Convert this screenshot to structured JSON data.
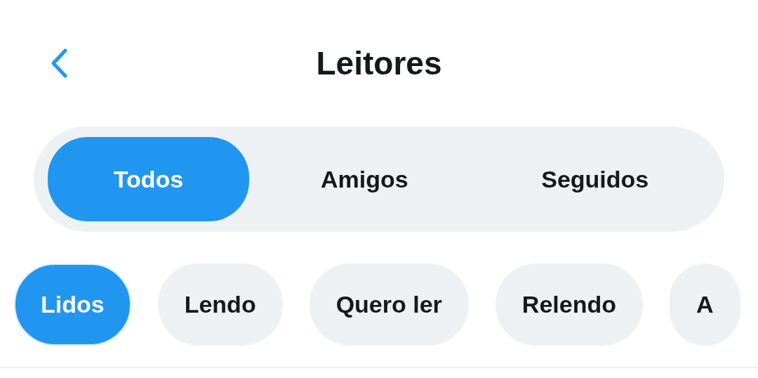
{
  "header": {
    "title": "Leitores"
  },
  "segments": [
    {
      "label": "Todos",
      "selected": true
    },
    {
      "label": "Amigos",
      "selected": false
    },
    {
      "label": "Seguidos",
      "selected": false
    }
  ],
  "filters": [
    {
      "label": "Lidos",
      "selected": true
    },
    {
      "label": "Lendo",
      "selected": false
    },
    {
      "label": "Quero ler",
      "selected": false
    },
    {
      "label": "Relendo",
      "selected": false
    },
    {
      "label": "A",
      "selected": false
    }
  ]
}
